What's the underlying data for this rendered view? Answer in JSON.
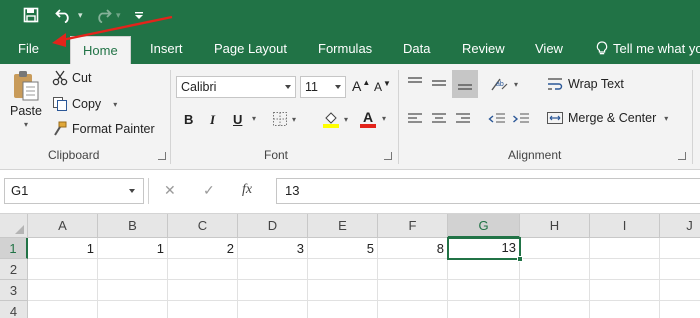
{
  "quick_access": {
    "icons": [
      "save-icon",
      "undo-icon",
      "redo-icon",
      "customize-icon"
    ]
  },
  "ribbon_tabs": [
    {
      "label": "File"
    },
    {
      "label": "Home"
    },
    {
      "label": "Insert"
    },
    {
      "label": "Page Layout"
    },
    {
      "label": "Formulas"
    },
    {
      "label": "Data"
    },
    {
      "label": "Review"
    },
    {
      "label": "View"
    },
    {
      "label": "Tell me what yo"
    }
  ],
  "active_tab": "Home",
  "clipboard": {
    "paste": "Paste",
    "cut": "Cut",
    "copy": "Copy",
    "format_painter": "Format Painter",
    "group_label": "Clipboard"
  },
  "font": {
    "family": "Calibri",
    "size": "11",
    "bold": "B",
    "italic": "I",
    "underline": "U",
    "grow": "A",
    "shrink": "A",
    "color_letter": "A",
    "group_label": "Font"
  },
  "alignment": {
    "wrap_text": "Wrap Text",
    "merge_center": "Merge & Center",
    "group_label": "Alignment"
  },
  "formula_bar": {
    "name_box": "G1",
    "fx": "fx",
    "value": "13"
  },
  "grid": {
    "columns": [
      "A",
      "B",
      "C",
      "D",
      "E",
      "F",
      "G",
      "H",
      "I",
      "J"
    ],
    "rows": [
      "1",
      "2",
      "3",
      "4"
    ],
    "row1_values": [
      "1",
      "1",
      "2",
      "3",
      "5",
      "8",
      "13"
    ],
    "selected_cell": "G1"
  },
  "colors": {
    "excel_green": "#217346",
    "annotation_red": "#e3241b"
  }
}
